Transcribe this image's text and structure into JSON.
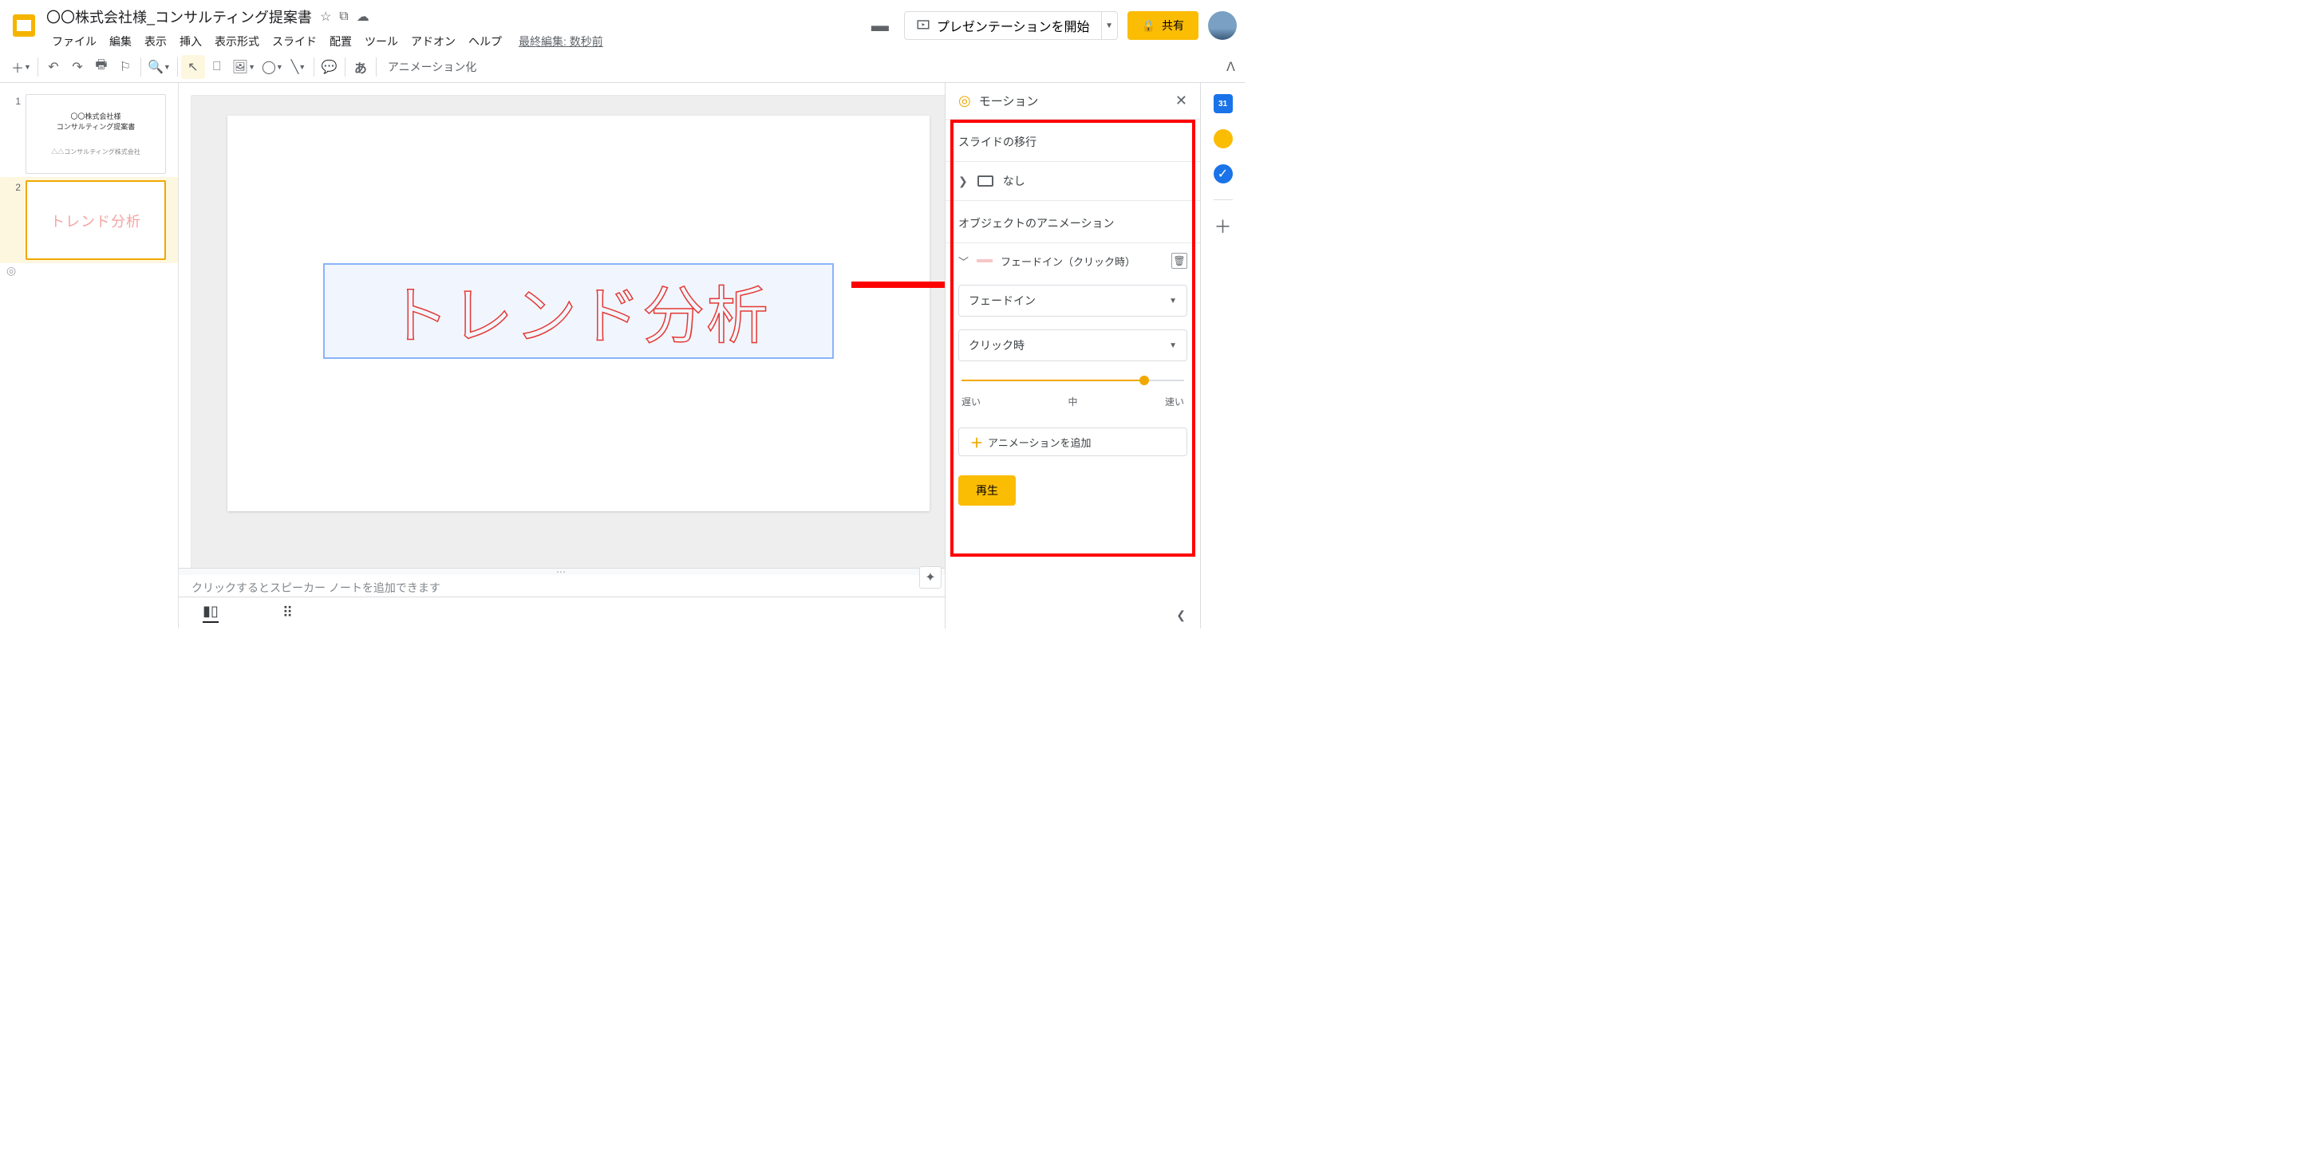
{
  "header": {
    "title": "〇〇株式会社様_コンサルティング提案書",
    "last_edit": "最終編集: 数秒前"
  },
  "menus": [
    "ファイル",
    "編集",
    "表示",
    "挿入",
    "表示形式",
    "スライド",
    "配置",
    "ツール",
    "アドオン",
    "ヘルプ"
  ],
  "header_buttons": {
    "present": "プレゼンテーションを開始",
    "share": "共有"
  },
  "toolbar": {
    "anim_label": "アニメーション化",
    "aa": "あ"
  },
  "thumbnails": [
    {
      "num": "1",
      "line1": "〇〇株式会社様",
      "line2": "コンサルティング提案書",
      "line3": "△△コンサルティング株式会社"
    },
    {
      "num": "2",
      "text": "トレンド分析"
    }
  ],
  "canvas": {
    "wordart_text": "トレンド分析"
  },
  "notes": {
    "placeholder": "クリックするとスピーカー ノートを追加できます"
  },
  "motion": {
    "title": "モーション",
    "sec_transition": "スライドの移行",
    "transition_value": "なし",
    "sec_object": "オブジェクトのアニメーション",
    "anim_item": "フェードイン（クリック時）",
    "select_effect": "フェードイン",
    "select_trigger": "クリック時",
    "speed_slow": "遅い",
    "speed_mid": "中",
    "speed_fast": "速い",
    "add_label": "アニメーションを追加",
    "play": "再生"
  },
  "side_rail": {
    "cal": "31"
  }
}
